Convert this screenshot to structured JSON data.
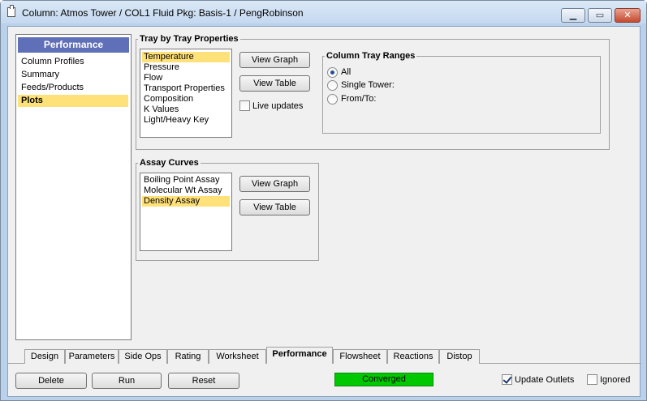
{
  "window": {
    "title": "Column: Atmos Tower / COL1  Fluid Pkg: Basis-1 / PengRobinson",
    "minimize_glyph": "▁",
    "maximize_glyph": "▭",
    "close_glyph": "✕"
  },
  "nav": {
    "header": "Performance",
    "items": [
      {
        "label": "Column Profiles",
        "selected": false
      },
      {
        "label": "Summary",
        "selected": false
      },
      {
        "label": "Feeds/Products",
        "selected": false
      },
      {
        "label": "Plots",
        "selected": true
      }
    ]
  },
  "tray_props": {
    "legend": "Tray by Tray Properties",
    "items": [
      {
        "label": "Temperature",
        "selected": true
      },
      {
        "label": "Pressure",
        "selected": false
      },
      {
        "label": "Flow",
        "selected": false
      },
      {
        "label": "Transport Properties",
        "selected": false
      },
      {
        "label": "Composition",
        "selected": false
      },
      {
        "label": "K Values",
        "selected": false
      },
      {
        "label": "Light/Heavy Key",
        "selected": false
      }
    ],
    "view_graph": "View Graph",
    "view_table": "View Table",
    "live_updates": "Live updates",
    "live_updates_checked": false
  },
  "ranges": {
    "legend": "Column Tray Ranges",
    "options": [
      {
        "label": "All",
        "selected": true
      },
      {
        "label": "Single Tower:",
        "selected": false
      },
      {
        "label": "From/To:",
        "selected": false
      }
    ]
  },
  "assay": {
    "legend": "Assay Curves",
    "items": [
      {
        "label": "Boiling Point Assay",
        "selected": false
      },
      {
        "label": "Molecular Wt Assay",
        "selected": false
      },
      {
        "label": "Density Assay",
        "selected": true
      }
    ],
    "view_graph": "View Graph",
    "view_table": "View Table"
  },
  "tabs": [
    {
      "label": "Design",
      "active": false
    },
    {
      "label": "Parameters",
      "active": false
    },
    {
      "label": "Side Ops",
      "active": false
    },
    {
      "label": "Rating",
      "active": false
    },
    {
      "label": "Worksheet",
      "active": false
    },
    {
      "label": "Performance",
      "active": true
    },
    {
      "label": "Flowsheet",
      "active": false
    },
    {
      "label": "Reactions",
      "active": false
    },
    {
      "label": "Distop",
      "active": false
    }
  ],
  "footer": {
    "delete": "Delete",
    "run": "Run",
    "reset": "Reset",
    "status": "Converged",
    "status_color": "#00c800",
    "update_outlets": "Update Outlets",
    "update_outlets_checked": true,
    "ignored": "Ignored",
    "ignored_checked": false
  }
}
